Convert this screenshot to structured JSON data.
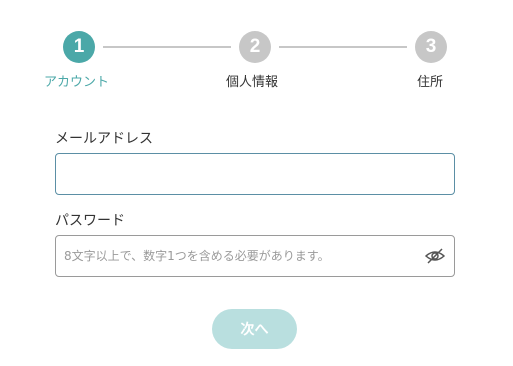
{
  "stepper": {
    "steps": [
      {
        "number": "1",
        "label": "アカウント",
        "state": "active"
      },
      {
        "number": "2",
        "label": "個人情報",
        "state": "inactive"
      },
      {
        "number": "3",
        "label": "住所",
        "state": "inactive"
      }
    ]
  },
  "form": {
    "email": {
      "label": "メールアドレス",
      "value": "",
      "placeholder": ""
    },
    "password": {
      "label": "パスワード",
      "value": "",
      "placeholder": "8文字以上で、数字1つを含める必要があります。",
      "toggle_icon": "eye-slash-icon"
    }
  },
  "actions": {
    "next_label": "次へ"
  },
  "colors": {
    "accent": "#4ba8a8",
    "inactive": "#c7c7c7",
    "button_disabled": "#b9dfdf"
  }
}
